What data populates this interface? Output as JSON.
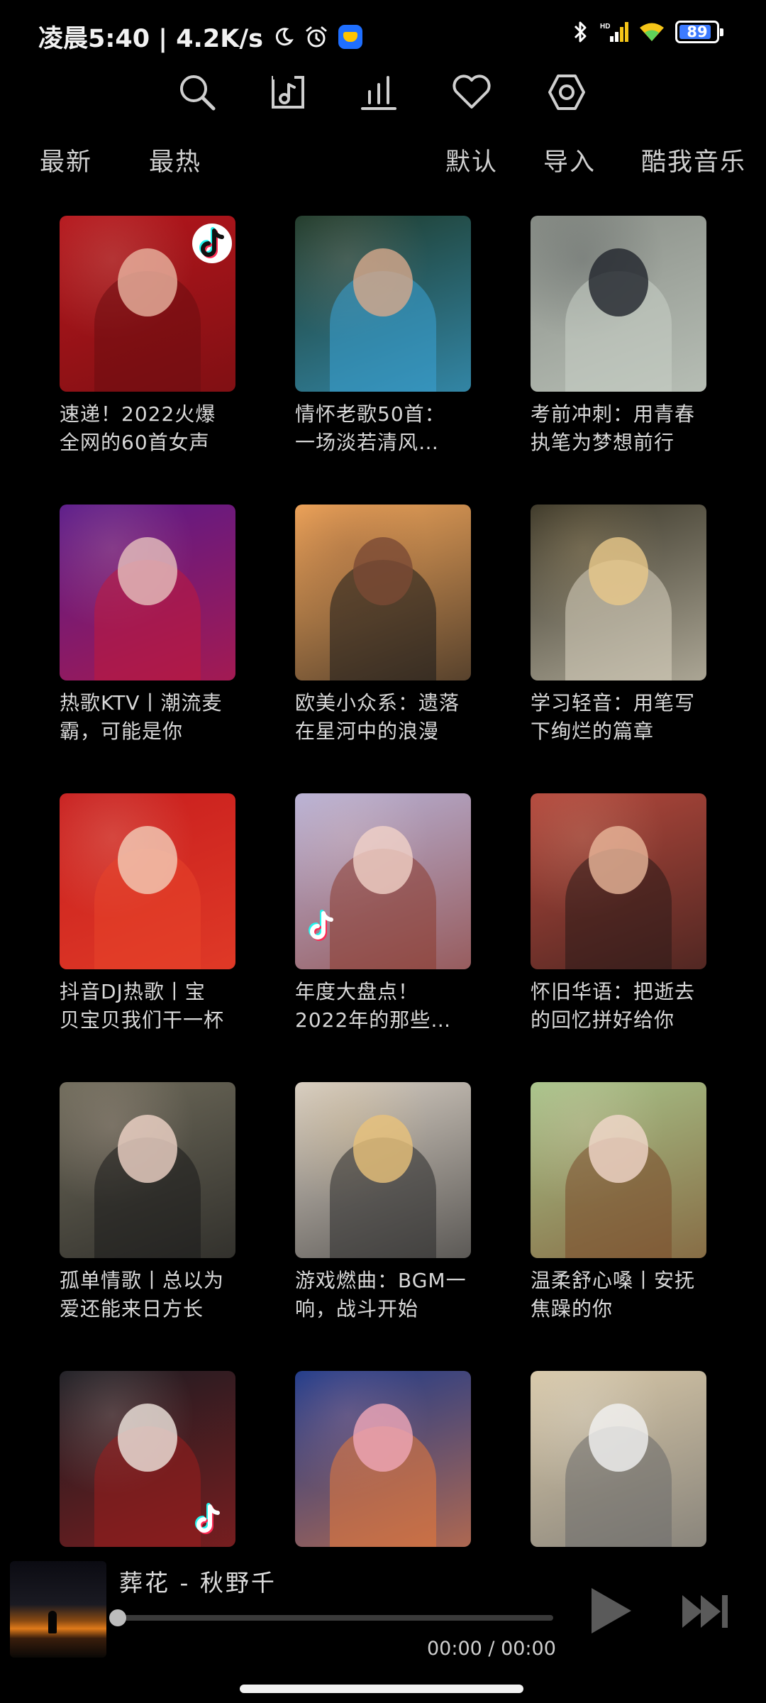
{
  "status_bar": {
    "time_text": "凌晨5:40 | 4.2K/s",
    "icons": [
      "moon-icon",
      "alarm-icon",
      "app-notification-icon",
      "bluetooth-icon",
      "hd-signal-icon",
      "wifi-icon"
    ],
    "battery": "89"
  },
  "toolbar": {
    "icons": [
      "search-icon",
      "music-folder-icon",
      "equalizer-icon",
      "heart-icon",
      "settings-icon"
    ]
  },
  "filters": {
    "latest": "最新",
    "hottest": "最热",
    "default": "默认",
    "import": "导入",
    "kuwo": "酷我音乐"
  },
  "playlists": [
    {
      "line1": "速递！2022火爆",
      "line2": "全网的60首女声",
      "colors": [
        "#b5161c",
        "#e8b4a0",
        "#6b0d10"
      ],
      "tiktok": "top-right"
    },
    {
      "line1": "情怀老歌50首：",
      "line2": "一场淡若清风…",
      "colors": [
        "#1e3a2a",
        "#d7a98c",
        "#3aa3d6"
      ],
      "tiktok": ""
    },
    {
      "line1": "考前冲刺：用青春",
      "line2": "执笔为梦想前行",
      "colors": [
        "#8a8f88",
        "#20242c",
        "#c8d0c6"
      ],
      "tiktok": ""
    },
    {
      "line1": "热歌KTV丨潮流麦",
      "line2": "霸，可能是你",
      "colors": [
        "#5a1a8a",
        "#e6c1bd",
        "#c01a3c"
      ],
      "tiktok": ""
    },
    {
      "line1": "欧美小众系：遗落",
      "line2": "在星河中的浪漫",
      "colors": [
        "#f0a55a",
        "#7a4a34",
        "#1a1a1a"
      ],
      "tiktok": ""
    },
    {
      "line1": "学习轻音：用笔写",
      "line2": "下绚烂的篇章",
      "colors": [
        "#3a3628",
        "#e8c889",
        "#d8d2c0"
      ],
      "tiktok": ""
    },
    {
      "line1": "抖音DJ热歌丨宝",
      "line2": "贝宝贝我们干一杯",
      "colors": [
        "#c81e1e",
        "#f2cdb8",
        "#e8442a"
      ],
      "tiktok": ""
    },
    {
      "line1": "年度大盘点！",
      "line2": "2022年的那些…",
      "colors": [
        "#b8b2d6",
        "#f1d2c8",
        "#8a3a2e"
      ],
      "tiktok": "bottom-left"
    },
    {
      "line1": "怀旧华语：把逝去",
      "line2": "的回忆拼好给你",
      "colors": [
        "#b4483c",
        "#e8b79a",
        "#2a1a18"
      ],
      "tiktok": ""
    },
    {
      "line1": "孤单情歌丨总以为",
      "line2": "爱还能来日方长",
      "colors": [
        "#6e6a5a",
        "#f0d4c8",
        "#1a1a1a"
      ],
      "tiktok": ""
    },
    {
      "line1": "游戏燃曲：BGM一",
      "line2": "响，战斗开始",
      "colors": [
        "#d8cfc4",
        "#e8c27a",
        "#2a2a2a"
      ],
      "tiktok": ""
    },
    {
      "line1": "温柔舒心嗓丨安抚",
      "line2": "焦躁的你",
      "colors": [
        "#a8c48a",
        "#f2d8cc",
        "#7a4a2a"
      ],
      "tiktok": ""
    },
    {
      "line1": "",
      "line2": "",
      "colors": [
        "#1c1c22",
        "#f0e6de",
        "#9a1e1e"
      ],
      "tiktok": "bottom-right"
    },
    {
      "line1": "",
      "line2": "",
      "colors": [
        "#1c3a8a",
        "#f0a8b8",
        "#e87a3a"
      ],
      "tiktok": ""
    },
    {
      "line1": "",
      "line2": "",
      "colors": [
        "#d8c8a8",
        "#f2f2f2",
        "#6a6a6a"
      ],
      "tiktok": ""
    }
  ],
  "player": {
    "title": "葬花 - 秋野千",
    "time": "00:00 / 00:00",
    "progress": 0
  }
}
